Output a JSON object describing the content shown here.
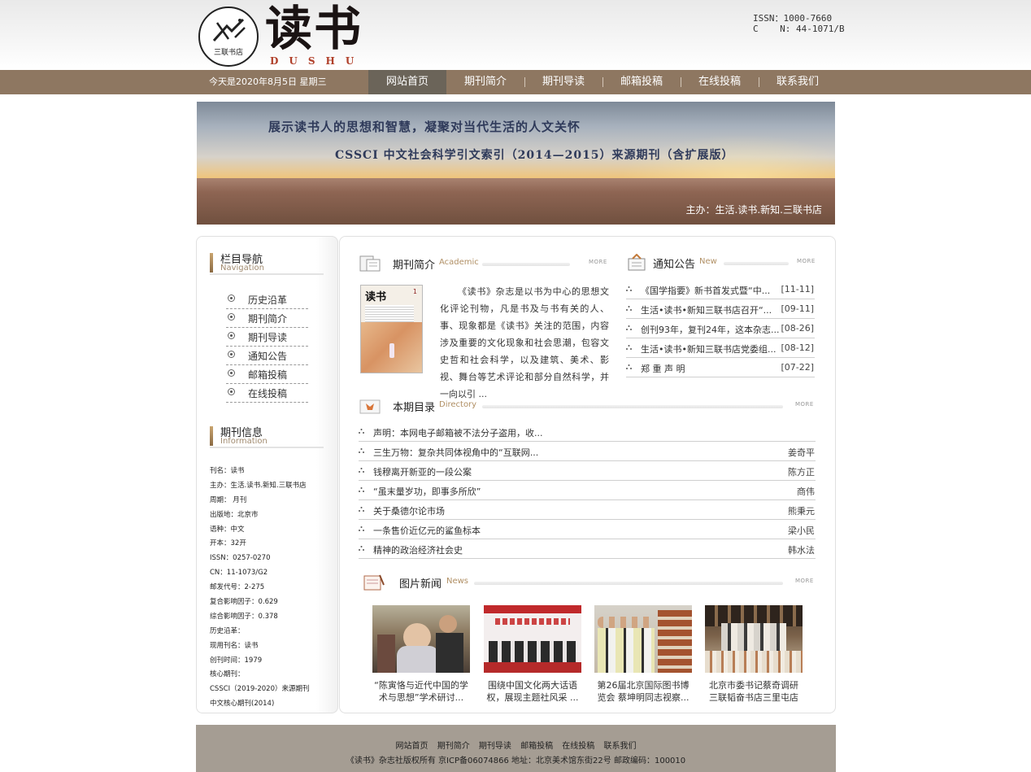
{
  "header": {
    "logo_text": "读书",
    "logo_sub": "DUSHU",
    "seal_text": "三联书店",
    "issn_line": "ISSN：1000-7660",
    "cn_line": "C    N: 44-1071/B"
  },
  "nav": {
    "date": "今天是2020年8月5日 星期三",
    "items": [
      "网站首页",
      "期刊简介",
      "期刊导读",
      "邮箱投稿",
      "在线投稿",
      "联系我们"
    ]
  },
  "banner": {
    "line1": "展示读书人的思想和智慧，凝聚对当代生活的人文关怀",
    "line2": "CSSCI 中文社会科学引文索引（2014—2015）来源期刊（含扩展版）",
    "host": "主办：生活.读书.新知.三联书店"
  },
  "sidebar": {
    "nav_title": "栏目导航",
    "nav_title_en": "Navigation",
    "nav_items": [
      "历史沿革",
      "期刊简介",
      "期刊导读",
      "通知公告",
      "邮箱投稿",
      "在线投稿"
    ],
    "info_title": "期刊信息",
    "info_title_en": "Information",
    "info": [
      "刊名：读书",
      "主办：生活.读书.新知.三联书店",
      "周期： 月刊",
      "出版地：北京市",
      "语种：中文",
      "开本：32开",
      "ISSN：0257-0270",
      "CN：11-1073/G2",
      "邮发代号：2-275",
      "复合影响因子：0.629",
      "综合影响因子：0.378",
      "历史沿革：",
      "现用刊名：读书",
      "创刊时间：1979",
      "核心期刊：",
      "CSSCI（2019-2020）来源期刊",
      "中文核心期刊(2014)"
    ]
  },
  "intro": {
    "title": "期刊简介",
    "title_en": "Academic",
    "more": "MORE",
    "cover_title": "读书",
    "cover_num": "1",
    "text": "《读书》杂志是以书为中心的思想文化评论刊物，凡是书及与书有关的人、事、现象都是《读书》关注的范围，内容涉及重要的文化现象和社会思潮，包容文史哲和社会科学，以及建筑、美术、影视、舞台等艺术评论和部分自然科学，并一向以引 ..."
  },
  "notices": {
    "title": "通知公告",
    "title_en": "New",
    "more": "MORE",
    "items": [
      {
        "title": "《国学指要》新书首发式暨“中...",
        "date": "[11-11]"
      },
      {
        "title": "生活•读书•新知三联书店召开“...",
        "date": "[09-11]"
      },
      {
        "title": "创刊93年，复刊24年，这本杂志...",
        "date": "[08-26]"
      },
      {
        "title": "生活•读书•新知三联书店党委组...",
        "date": "[08-12]"
      },
      {
        "title": "郑 重 声 明",
        "date": "[07-22]"
      }
    ]
  },
  "directory": {
    "title": "本期目录",
    "title_en": "Directory",
    "more": "MORE",
    "items": [
      {
        "title": "声明：本网电子邮箱被不法分子盗用，收...",
        "author": ""
      },
      {
        "title": "三生万物：复杂共同体视角中的“互联网...",
        "author": "姜奇平"
      },
      {
        "title": "钱穆离开新亚的一段公案",
        "author": "陈方正"
      },
      {
        "title": "“虽末量岁功，即事多所欣”",
        "author": "商伟"
      },
      {
        "title": "关于桑德尔论市场",
        "author": "熊秉元"
      },
      {
        "title": "一条售价近亿元的鲨鱼标本",
        "author": "梁小民"
      },
      {
        "title": "精神的政治经济社会史",
        "author": "韩水法"
      }
    ]
  },
  "photo_news": {
    "title": "图片新闻",
    "title_en": "News",
    "more": "MORE",
    "items": [
      {
        "caption": "“陈寅恪与近代中国的学术与思想”学术研讨..."
      },
      {
        "caption": "围绕中国文化两大话语权，展现主题社风采 ..."
      },
      {
        "caption": "第26届北京国际图书博览会 蔡坤明同志视察..."
      },
      {
        "caption": "北京市委书记蔡奇调研三联韬奋书店三里屯店"
      }
    ]
  },
  "footer": {
    "links": [
      "网站首页",
      "期刊简介",
      "期刊导读",
      "邮箱投稿",
      "在线投稿",
      "联系我们"
    ],
    "copyright": "《读书》杂志社版权所有  京ICP备06074866  地址：北京美术馆东街22号  邮政编码：100010"
  },
  "colors": {
    "nav_bg": "#8e7761",
    "nav_active": "#6b6459",
    "footer_bg": "#a59d93",
    "accent": "#b08f64"
  }
}
